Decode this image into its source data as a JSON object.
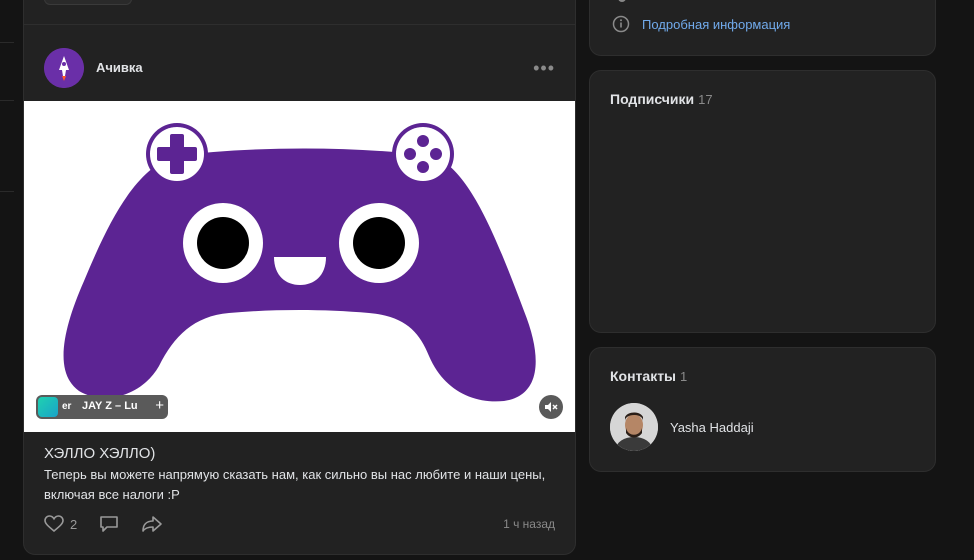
{
  "post": {
    "author": "Ачивка",
    "more": "•••",
    "music": {
      "prefix": "er",
      "track": "JAY Z – Lu",
      "add": "+"
    },
    "title": "ХЭЛЛО ХЭЛЛО)",
    "text": "Теперь вы можете напрямую сказать нам, как сильно вы нас любите и наши цены, включая все налоги :P",
    "likes": "2",
    "time": "1 ч назад"
  },
  "info": {
    "link": "Подробная информация"
  },
  "subscribers": {
    "title": "Подписчики",
    "count": "17"
  },
  "contacts": {
    "title": "Контакты",
    "count": "1",
    "items": [
      {
        "name": "Yasha Haddaji"
      }
    ]
  },
  "colors": {
    "accent_link": "#71aaeb",
    "controller_purple": "#5c2493",
    "card_bg": "#222222",
    "page_bg": "#141414"
  }
}
